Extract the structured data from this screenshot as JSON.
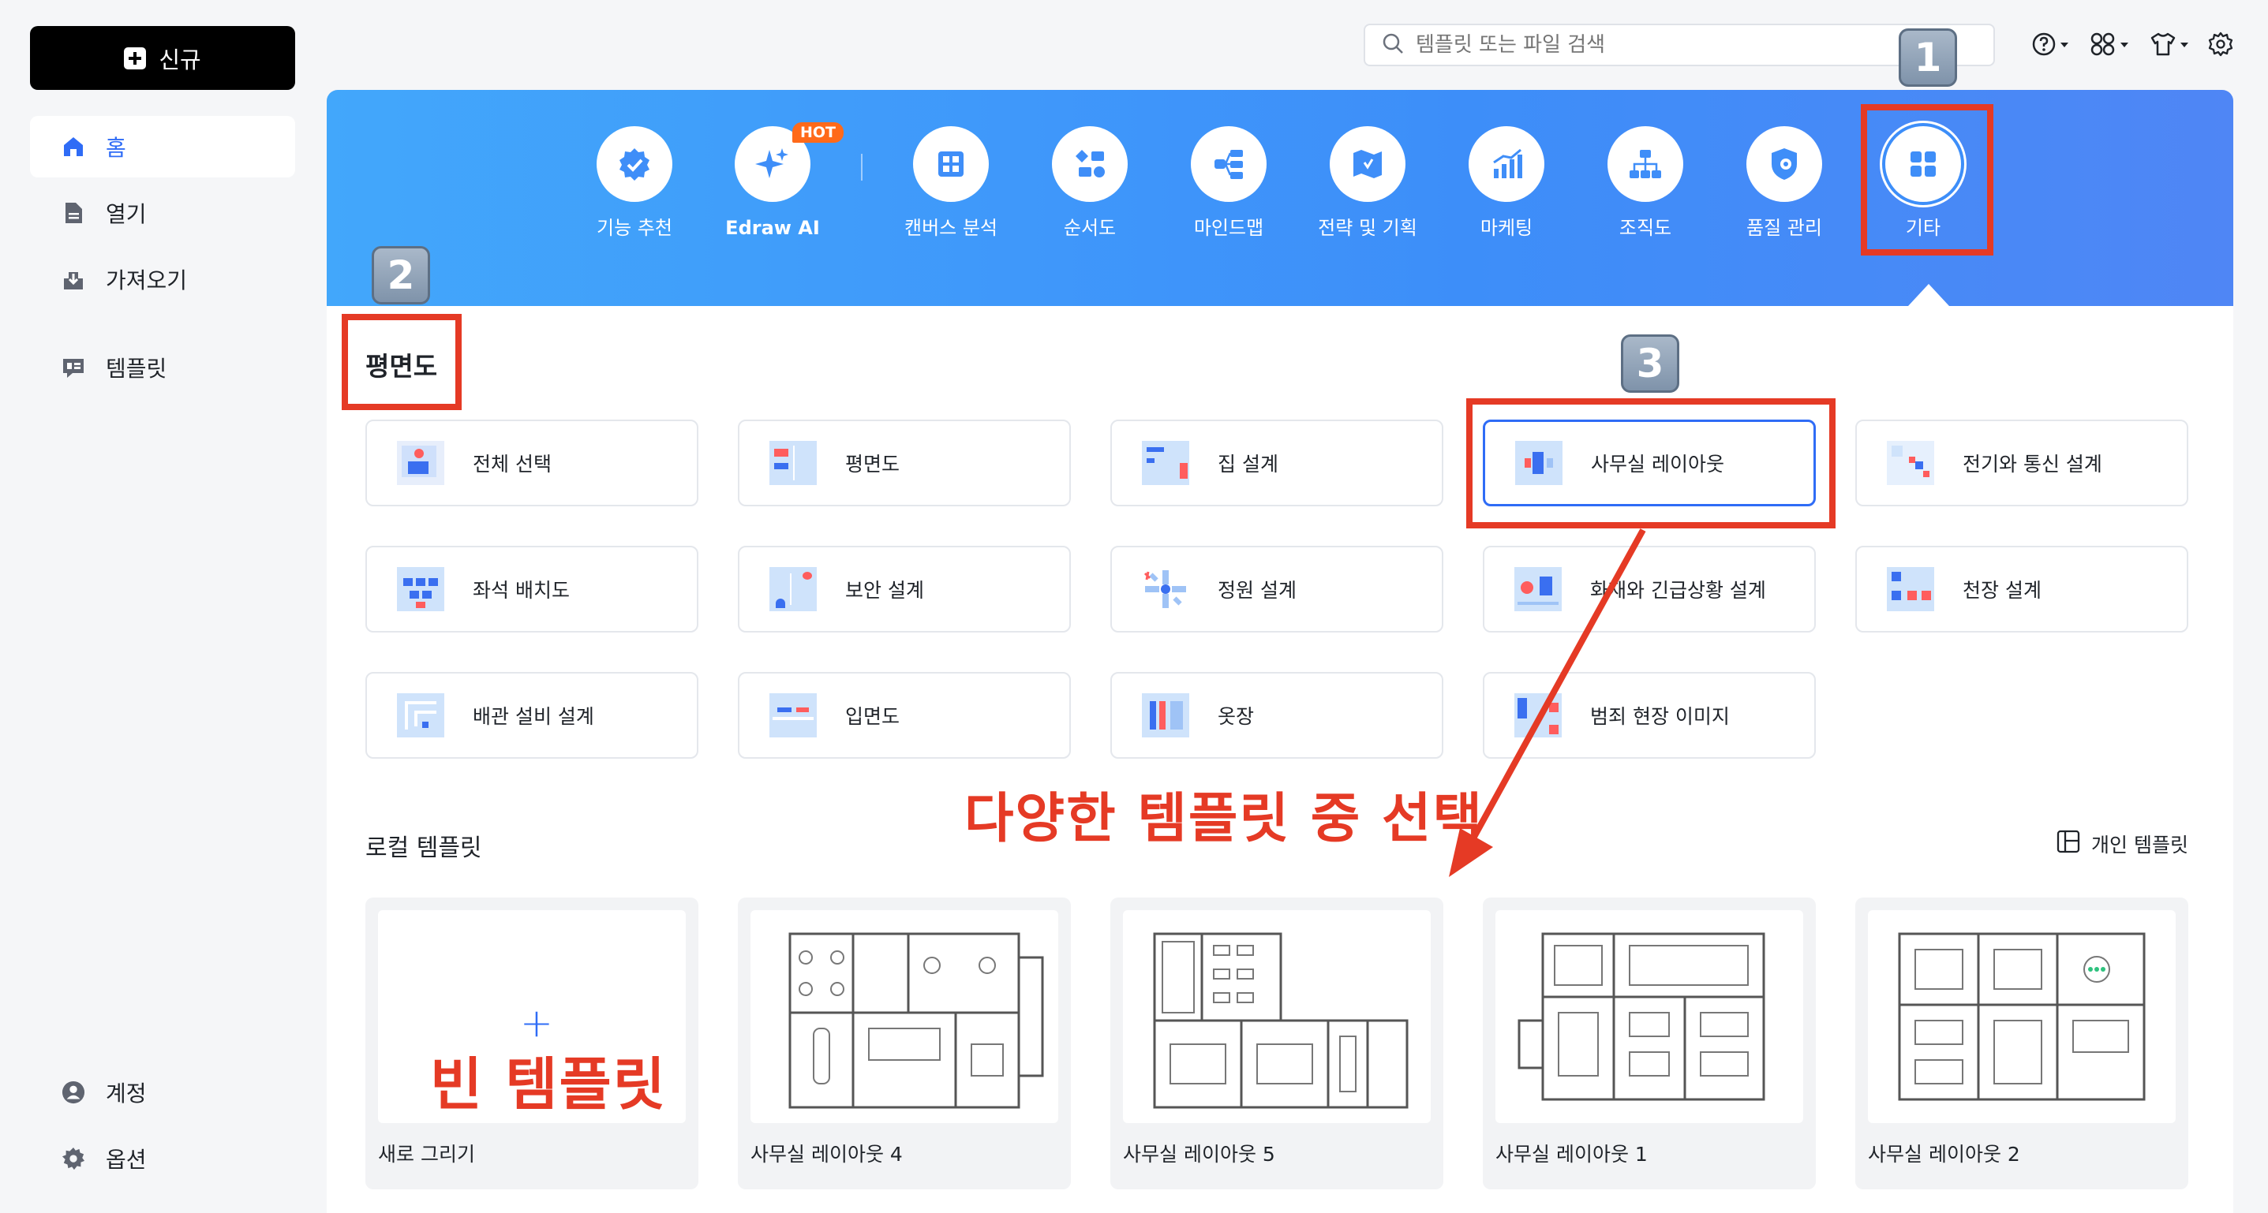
{
  "sidebar": {
    "new_label": "신규",
    "items": [
      {
        "label": "홈"
      },
      {
        "label": "열기"
      },
      {
        "label": "가져오기"
      },
      {
        "label": "템플릿"
      }
    ],
    "bottom": [
      {
        "label": "계정"
      },
      {
        "label": "옵션"
      }
    ]
  },
  "search": {
    "placeholder": "템플릿 또는 파일 검색"
  },
  "categories": [
    {
      "label": "기능 추천",
      "icon": "badge-check-icon"
    },
    {
      "label": "Edraw AI",
      "icon": "sparkle-icon",
      "badge": "HOT"
    },
    {
      "label": "캔버스 분석",
      "icon": "grid-icon"
    },
    {
      "label": "순서도",
      "icon": "flowchart-icon"
    },
    {
      "label": "마인드맵",
      "icon": "mindmap-icon"
    },
    {
      "label": "전략 및 기획",
      "icon": "map-icon"
    },
    {
      "label": "마케팅",
      "icon": "chart-icon"
    },
    {
      "label": "조직도",
      "icon": "org-chart-icon"
    },
    {
      "label": "품질 관리",
      "icon": "quality-icon"
    },
    {
      "label": "기타",
      "icon": "apps-icon"
    }
  ],
  "floorplan": {
    "title": "평면도",
    "templates": [
      {
        "label": "전체 선택"
      },
      {
        "label": "평면도"
      },
      {
        "label": "집 설계"
      },
      {
        "label": "사무실 레이아웃",
        "selected": true
      },
      {
        "label": "전기와 통신 설계"
      },
      {
        "label": "좌석 배치도"
      },
      {
        "label": "보안 설계"
      },
      {
        "label": "정원 설계"
      },
      {
        "label": "화재와 긴급상황 설계"
      },
      {
        "label": "천장 설계"
      },
      {
        "label": "배관 설비 설계"
      },
      {
        "label": "입면도"
      },
      {
        "label": "옷장"
      },
      {
        "label": "범죄 현장 이미지"
      }
    ]
  },
  "local": {
    "title": "로컬 템플릿",
    "personal_label": "개인 템플릿",
    "cards": [
      {
        "label": "새로 그리기"
      },
      {
        "label": "사무실 레이아웃 4"
      },
      {
        "label": "사무실 레이아웃 5"
      },
      {
        "label": "사무실 레이아웃 1"
      },
      {
        "label": "사무실 레이아웃 2"
      }
    ]
  },
  "annotations": {
    "badge1": "1",
    "badge2": "2",
    "badge3": "3",
    "callout": "다양한 템플릿 중 선택",
    "blank_template": "빈 템플릿"
  },
  "colors": {
    "accent": "#2f6cf6",
    "annotation_red": "#e53a25",
    "banner_blue": "#3d8ef9"
  }
}
